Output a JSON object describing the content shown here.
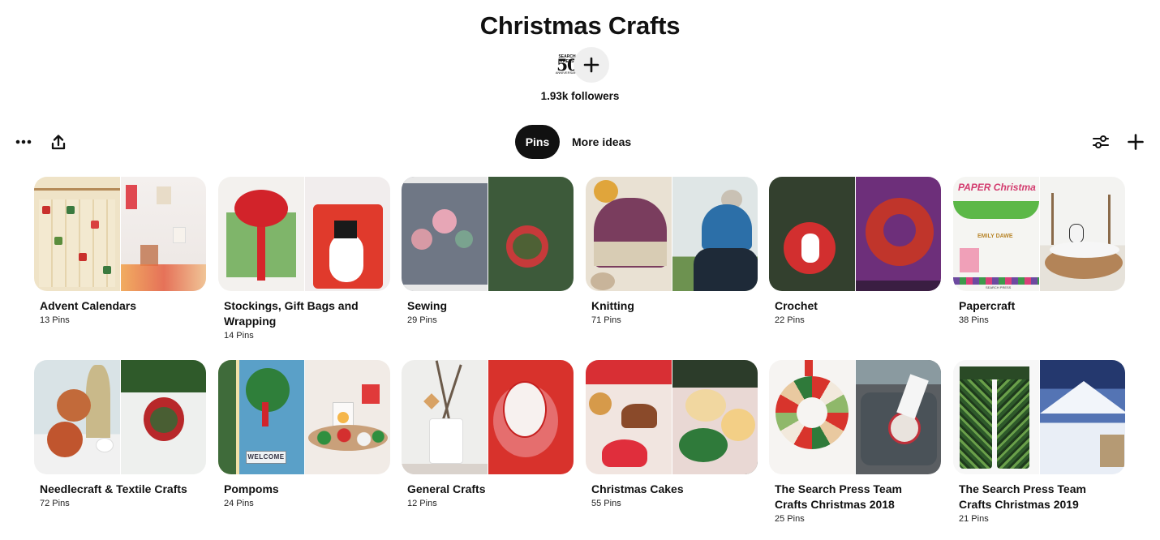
{
  "board": {
    "title": "Christmas Crafts",
    "followers": "1.93k followers",
    "avatar": {
      "top_text": "SEARCH PRESS",
      "main_text": "50",
      "bottom_text": "ANNIVERSARY"
    }
  },
  "toolbar": {
    "more_icon": "ellipsis-icon",
    "share_icon": "share-upload-icon",
    "filter_icon": "sliders-icon",
    "add_icon": "plus-icon"
  },
  "tabs": [
    {
      "label": "Pins",
      "active": true
    },
    {
      "label": "More ideas",
      "active": false
    }
  ],
  "sections": [
    {
      "title": "Advent Calendars",
      "count": "13 Pins"
    },
    {
      "title": "Stockings, Gift Bags and Wrapping",
      "count": "14 Pins"
    },
    {
      "title": "Sewing",
      "count": "29 Pins"
    },
    {
      "title": "Knitting",
      "count": "71 Pins"
    },
    {
      "title": "Crochet",
      "count": "22 Pins"
    },
    {
      "title": "Papercraft",
      "count": "38 Pins",
      "cover_text": {
        "headline": "PAPER Christmas",
        "author": "EMILY DAWE",
        "publisher": "SEARCH PRESS"
      }
    },
    {
      "title": "Needlecraft & Textile Crafts",
      "count": "72 Pins"
    },
    {
      "title": "Pompoms",
      "count": "24 Pins",
      "sign_text": "WELCOME"
    },
    {
      "title": "General Crafts",
      "count": "12 Pins"
    },
    {
      "title": "Christmas Cakes",
      "count": "55 Pins"
    },
    {
      "title": "The Search Press Team Crafts Christmas 2018",
      "count": "25 Pins"
    },
    {
      "title": "The Search Press Team Crafts Christmas 2019",
      "count": "21 Pins"
    }
  ],
  "colors": {
    "active_tab": "#111111",
    "add_collaborator_bg": "#efefef",
    "text": "#111111"
  }
}
